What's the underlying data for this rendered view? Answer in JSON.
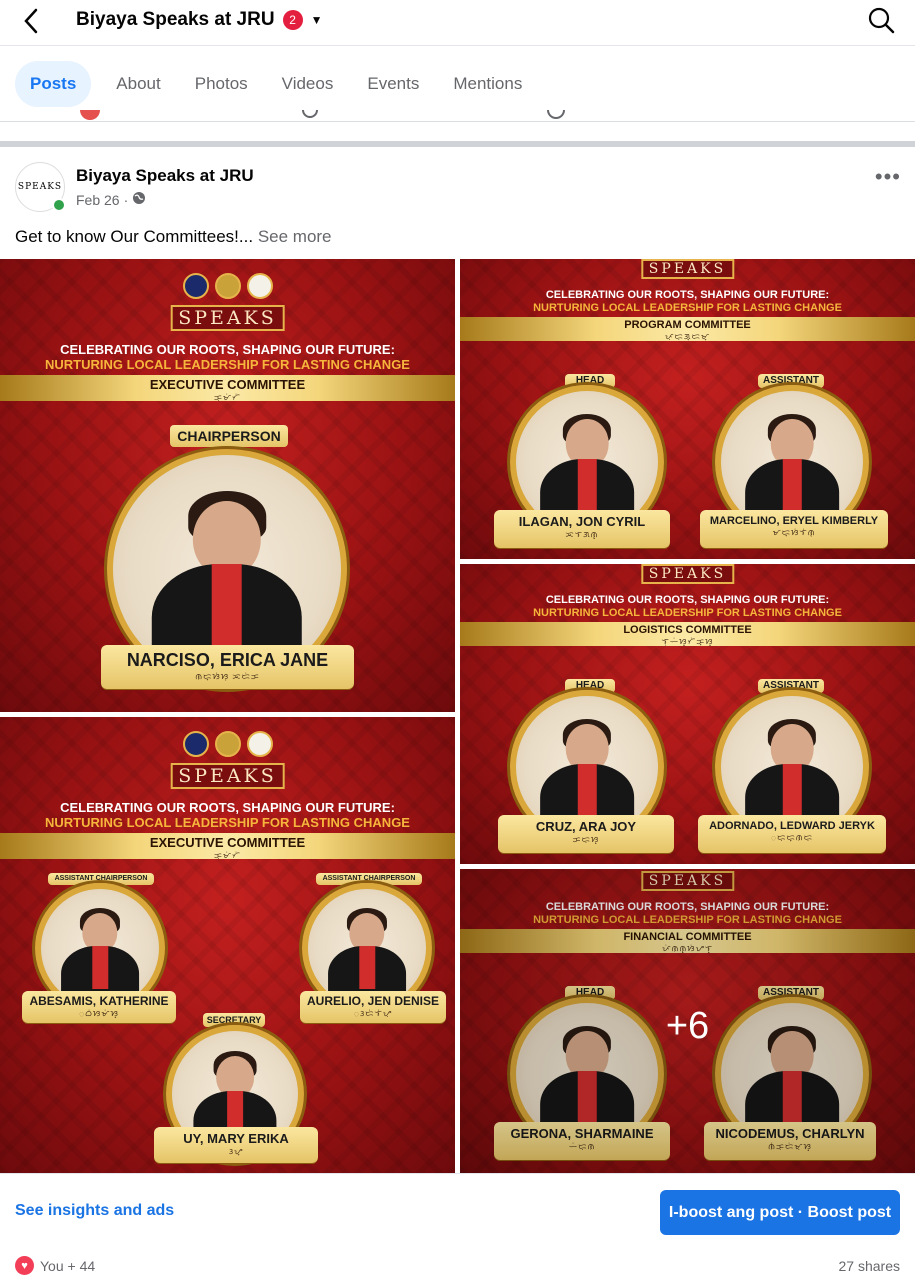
{
  "header": {
    "title": "Biyaya Speaks at JRU",
    "badge": "2"
  },
  "tabs": [
    {
      "label": "Posts",
      "active": true
    },
    {
      "label": "About"
    },
    {
      "label": "Photos"
    },
    {
      "label": "Videos"
    },
    {
      "label": "Events"
    },
    {
      "label": "Mentions"
    }
  ],
  "post": {
    "author": "Biyaya Speaks at JRU",
    "avatar_text": "SPEAKS",
    "date": "Feb 26",
    "caption": "Get to know Our Committees!...",
    "see_more": "See more"
  },
  "images": {
    "logo": "SPEAKS",
    "headline": "CELEBRATING OUR ROOTS, SHAPING OUR FUTURE:",
    "subheadline": "NURTURING LOCAL LEADERSHIP FOR LASTING CHANGE",
    "exec": {
      "committee": "EXECUTIVE COMMITTEE",
      "role": "CHAIRPERSON",
      "name": "NARCISO, ERICA JANE"
    },
    "program": {
      "committee": "PROGRAM COMMITTEE",
      "head_label": "HEAD",
      "head_name": "ILAGAN, JON CYRIL",
      "asst_label": "ASSISTANT",
      "asst_name": "MARCELINO, ERYEL KIMBERLY"
    },
    "logistics": {
      "committee": "LOGISTICS COMMITTEE",
      "head_label": "HEAD",
      "head_name": "CRUZ, ARA JOY",
      "asst_label": "ASSISTANT",
      "asst_name": "ADORNADO, LEDWARD JERYK"
    },
    "exec2": {
      "committee": "EXECUTIVE COMMITTEE",
      "ac1_label": "ASSISTANT CHAIRPERSON",
      "ac1_name": "ABESAMIS, KATHERINE",
      "ac2_label": "ASSISTANT CHAIRPERSON",
      "ac2_name": "AURELIO, JEN DENISE",
      "sec_label": "SECRETARY",
      "sec_name": "UY, MARY ERIKA"
    },
    "financial": {
      "committee": "FINANCIAL COMMITTEE",
      "head_label": "HEAD",
      "head_name": "GERONA, SHARMAINE",
      "asst_label": "ASSISTANT",
      "asst_name": "NICODEMUS, CHARLYN"
    },
    "more_count": "+6"
  },
  "footer": {
    "insights": "See insights and ads",
    "boost": "I-boost ang post · Boost post",
    "reactions": "You + 44",
    "shares": "27 shares"
  }
}
